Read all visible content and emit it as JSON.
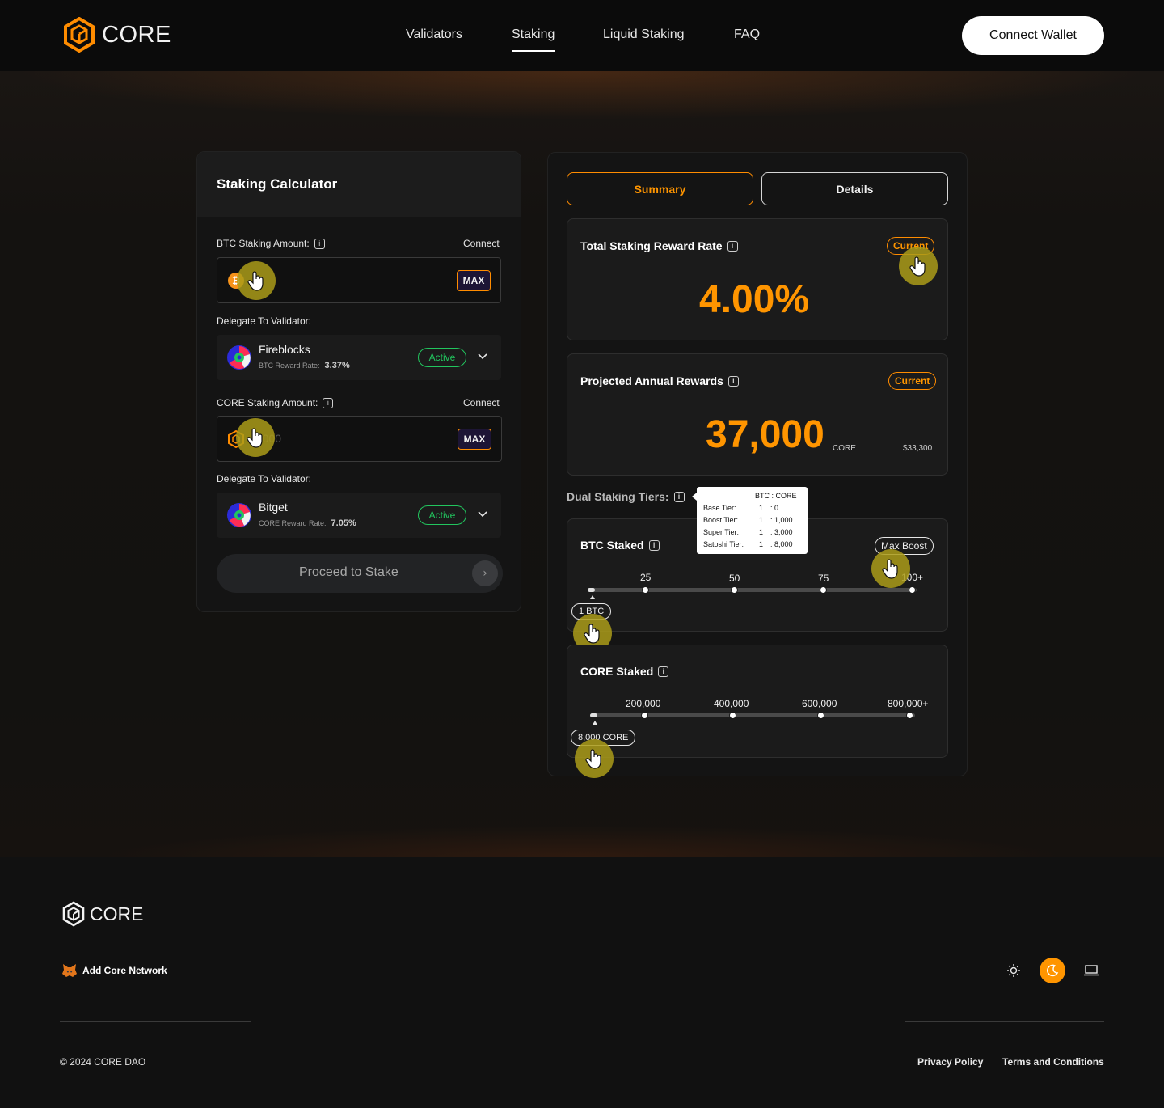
{
  "header": {
    "logo_text": "CORE",
    "nav": [
      {
        "label": "Validators"
      },
      {
        "label": "Staking"
      },
      {
        "label": "Liquid Staking"
      },
      {
        "label": "FAQ"
      }
    ],
    "active_nav": "Staking",
    "connect_wallet": "Connect Wallet"
  },
  "calculator": {
    "title": "Staking Calculator",
    "btc": {
      "label": "BTC Staking Amount:",
      "connect": "Connect",
      "value": "1",
      "max": "MAX",
      "delegate_label": "Delegate To Validator:",
      "validator": {
        "name": "Fireblocks",
        "rate_label": "BTC Reward Rate:",
        "rate": "3.37%",
        "status": "Active"
      }
    },
    "core": {
      "label": "CORE Staking Amount:",
      "connect": "Connect",
      "value": "8,000",
      "max": "MAX",
      "delegate_label": "Delegate To Validator:",
      "validator": {
        "name": "Bitget",
        "rate_label": "CORE Reward Rate:",
        "rate": "7.05%",
        "status": "Active"
      }
    },
    "proceed": "Proceed to Stake"
  },
  "results": {
    "tabs": [
      {
        "label": "Summary"
      },
      {
        "label": "Details"
      }
    ],
    "active_tab": "Summary",
    "reward_rate": {
      "title": "Total Staking Reward Rate",
      "badge": "Current",
      "value": "4.00%"
    },
    "annual_rewards": {
      "title": "Projected Annual Rewards",
      "badge": "Current",
      "value": "37,000",
      "unit": "CORE",
      "usd": "$33,300"
    },
    "tiers": {
      "label": "Dual Staking Tiers:",
      "tooltip": {
        "header": "BTC : CORE",
        "rows": [
          {
            "name": "Base Tier:",
            "btc": "1",
            "core": ":   0"
          },
          {
            "name": "Boost Tier:",
            "btc": "1",
            "core": ": 1,000"
          },
          {
            "name": "Super Tier:",
            "btc": "1",
            "core": ": 3,000"
          },
          {
            "name": "Satoshi Tier:",
            "btc": "1",
            "core": ": 8,000"
          }
        ]
      }
    },
    "btc_staked": {
      "title": "BTC Staked",
      "badge": "Max Boost",
      "ticks": [
        "25",
        "50",
        "75",
        "100+"
      ],
      "current": "1 BTC",
      "level": 0.01
    },
    "core_staked": {
      "title": "CORE Staked",
      "ticks": [
        "200,000",
        "400,000",
        "600,000",
        "800,000+"
      ],
      "current": "8,000 CORE",
      "level": 0.01
    }
  },
  "footer": {
    "logo_text": "CORE",
    "add_network": "Add Core Network",
    "copyright": "© 2024 CORE DAO",
    "links": [
      {
        "label": "Privacy Policy"
      },
      {
        "label": "Terms and Conditions"
      }
    ]
  },
  "theme": {
    "accent": "#ff9500",
    "active_green": "#22c55e"
  }
}
